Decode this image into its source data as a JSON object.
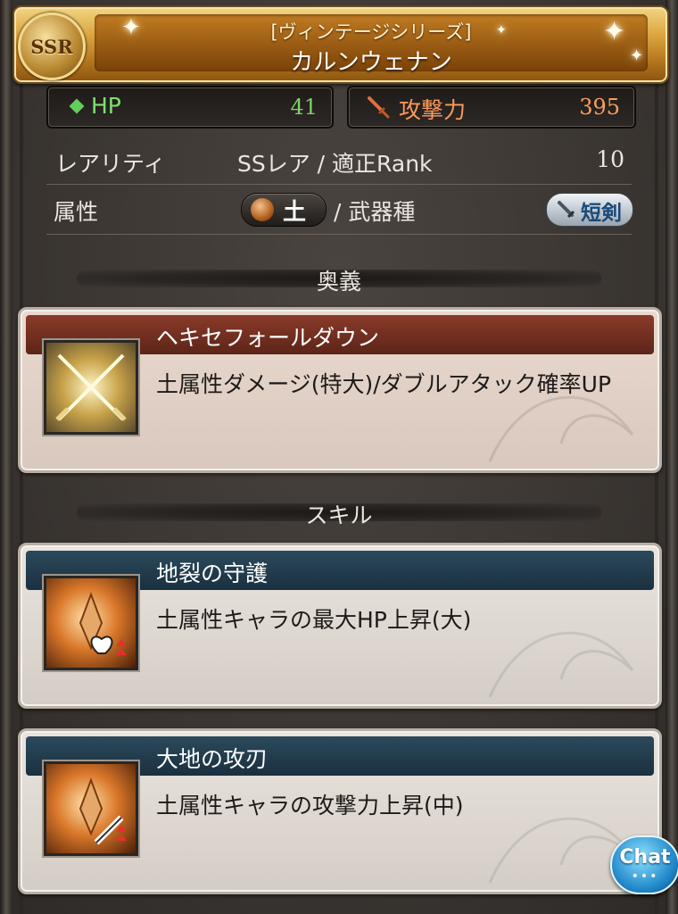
{
  "header": {
    "rarity_badge": "SSR",
    "series": "[ヴィンテージシリーズ]",
    "title": "カルンウェナン"
  },
  "stats": {
    "hp_label": "HP",
    "hp_value": "41",
    "atk_label": "攻撃力",
    "atk_value": "395"
  },
  "info": {
    "rarity_label": "レアリティ",
    "rarity_value": "SSレア / 適正Rank",
    "rank_value": "10",
    "element_label": "属性",
    "element_value": "土",
    "weapon_type_label": "/ 武器種",
    "weapon_type_value": "短剣"
  },
  "ougi": {
    "section_title": "奥義",
    "name": "ヘキセフォールダウン",
    "description": "土属性ダメージ(特大)/ダブルアタック確率UP"
  },
  "skills": {
    "section_title": "スキル",
    "items": [
      {
        "name": "地裂の守護",
        "description": "土属性キャラの最大HP上昇(大)",
        "icon": "earth-hp-up-icon"
      },
      {
        "name": "大地の攻刃",
        "description": "土属性キャラの攻撃力上昇(中)",
        "icon": "earth-atk-up-icon"
      }
    ]
  },
  "chat": {
    "label": "Chat",
    "dots": "•••"
  },
  "colors": {
    "hp": "#7fd06a",
    "atk": "#ff9c5c",
    "ougi_bar": "#6e2d1f",
    "skill_bar": "#1f3a4c"
  }
}
